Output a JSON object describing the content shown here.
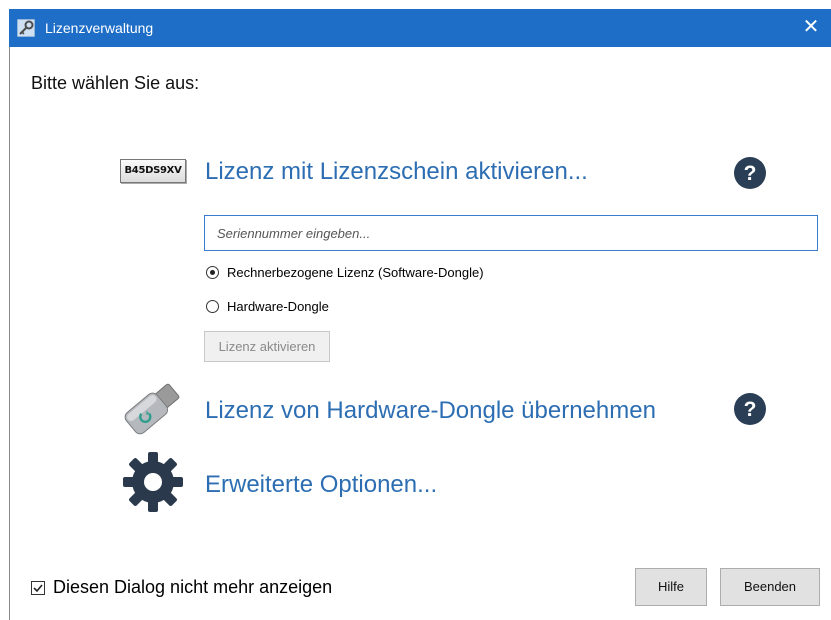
{
  "window": {
    "title": "Lizenzverwaltung",
    "close_glyph": "✕"
  },
  "prompt": "Bitte wählen Sie aus:",
  "serial_option": {
    "icon_text": "B45DS9XV",
    "link": "Lizenz mit Lizenzschein aktivieren...",
    "input": {
      "value": "",
      "placeholder": "Seriennummer eingeben..."
    },
    "radios": [
      {
        "label": "Rechnerbezogene Lizenz (Software-Dongle)",
        "checked": true
      },
      {
        "label": "Hardware-Dongle",
        "checked": false
      }
    ],
    "activate_button": "Lizenz aktivieren"
  },
  "dongle_option": {
    "link": "Lizenz von Hardware-Dongle übernehmen"
  },
  "advanced_option": {
    "link": "Erweiterte Optionen..."
  },
  "footer": {
    "checkbox_label": "Diesen Dialog nicht mehr anzeigen",
    "checkbox_checked": true,
    "help_button": "Hilfe",
    "exit_button": "Beenden"
  },
  "colors": {
    "titlebar": "#1e6ec7",
    "link": "#2d6eb3",
    "help_icon": "#2a3f55"
  },
  "icons": [
    "key-icon",
    "close-icon",
    "serial-number-icon",
    "help-icon",
    "usb-dongle-icon",
    "gear-icon",
    "checkmark-icon"
  ]
}
